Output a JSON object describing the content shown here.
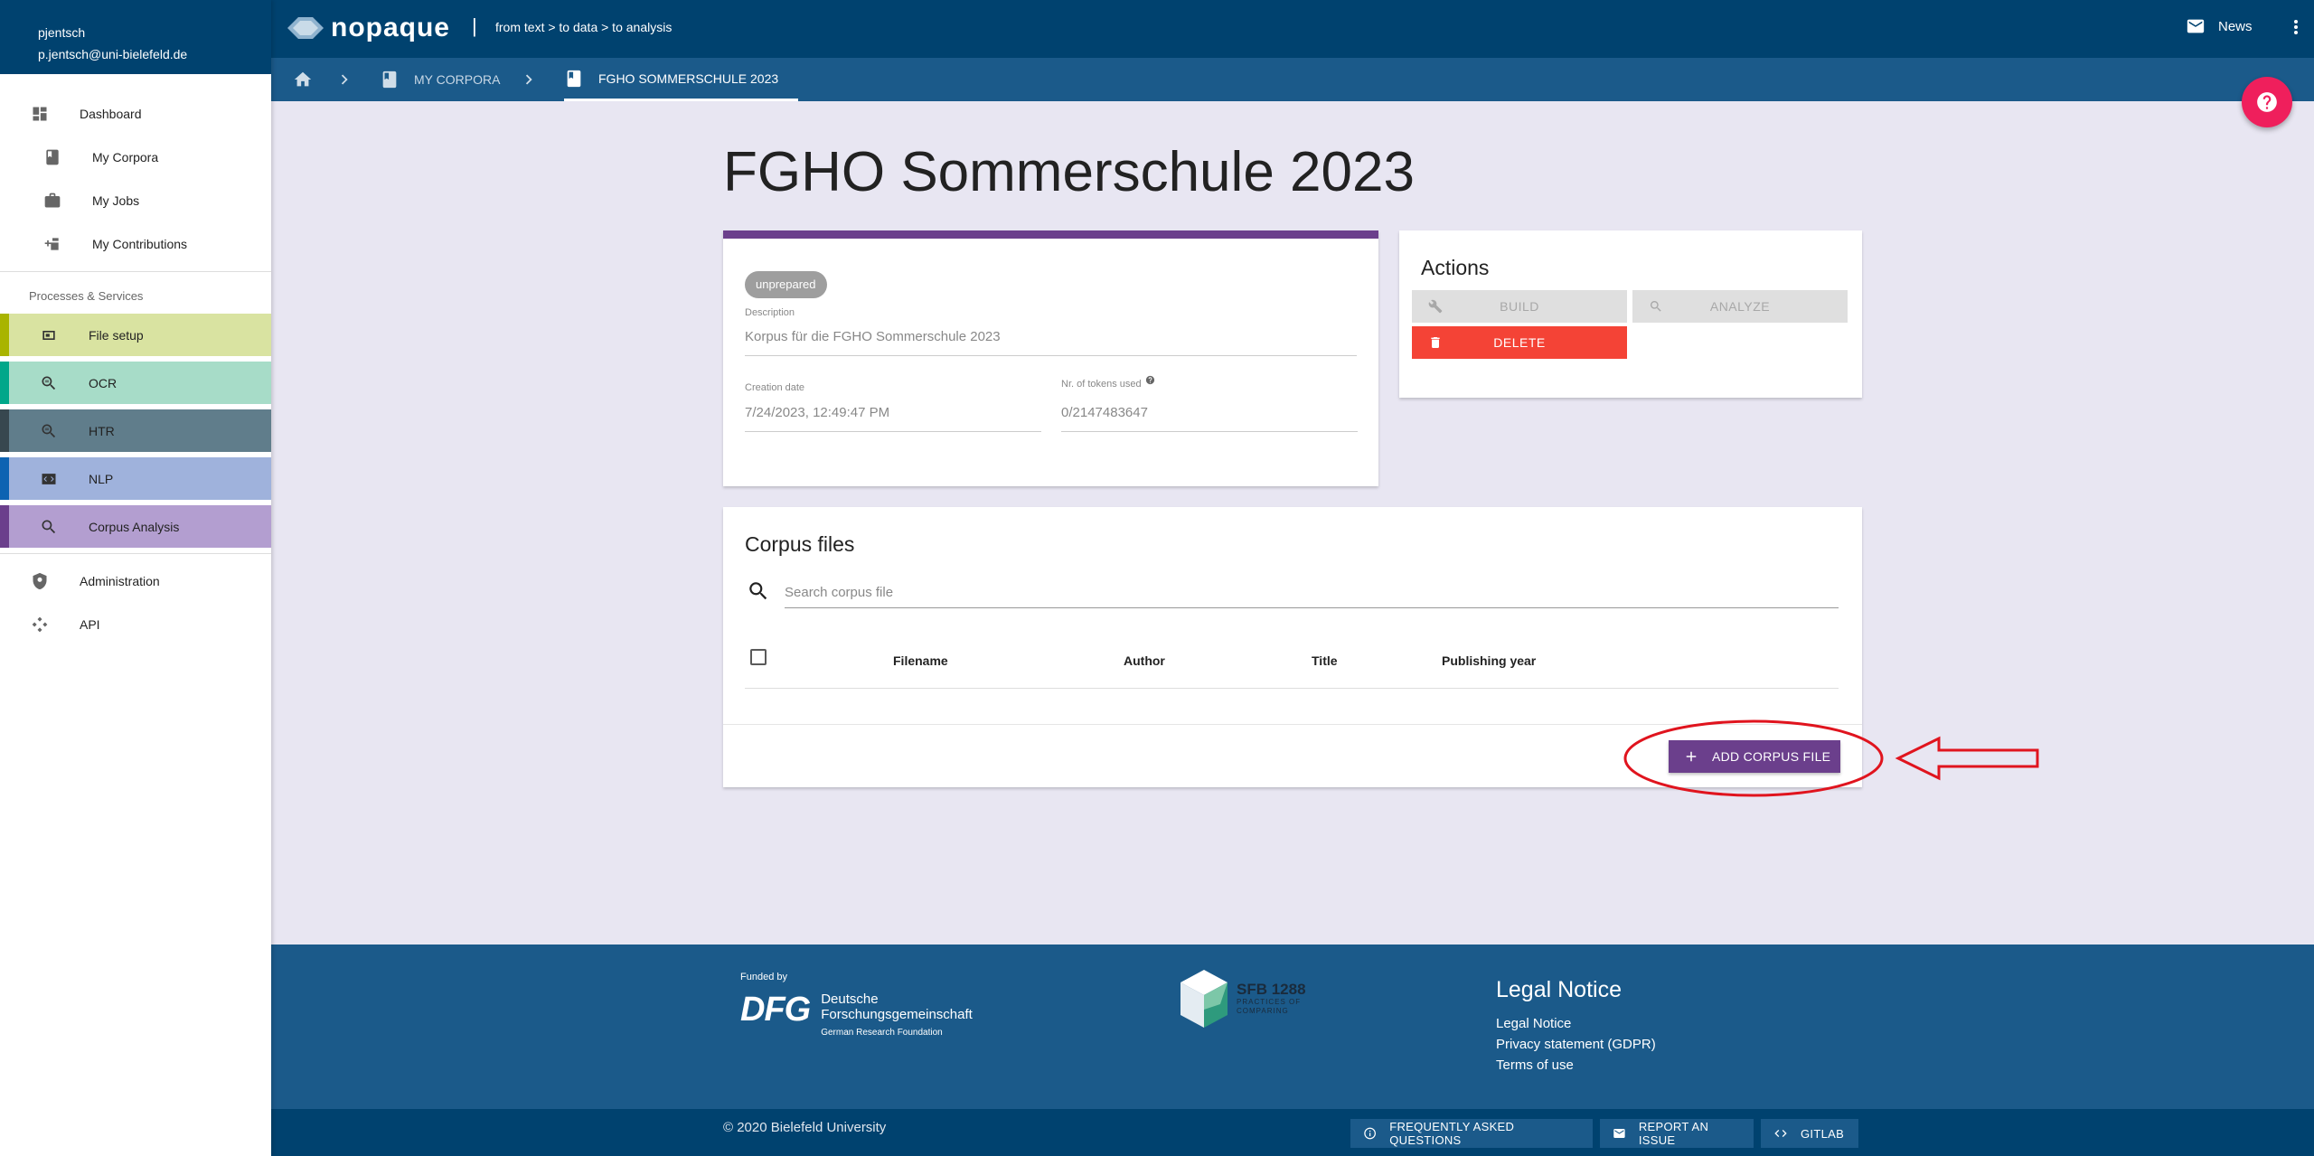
{
  "user": {
    "name": "pjentsch",
    "email": "p.jentsch@uni-bielefeld.de"
  },
  "sidebar": {
    "dashboard": "Dashboard",
    "my_corpora": "My Corpora",
    "my_jobs": "My Jobs",
    "my_contributions": "My Contributions",
    "processes_header": "Processes & Services",
    "services": [
      {
        "label": "File setup",
        "bg": "#d9e3a1",
        "accent": "#a9b400"
      },
      {
        "label": "OCR",
        "bg": "#a7dcc8",
        "accent": "#00a78a"
      },
      {
        "label": "HTR",
        "bg": "#607d8b",
        "accent": "#37474f"
      },
      {
        "label": "NLP",
        "bg": "#9fb2dc",
        "accent": "#0d63b2"
      },
      {
        "label": "Corpus Analysis",
        "bg": "#b39ed0",
        "accent": "#6b3f8c"
      }
    ],
    "administration": "Administration",
    "api": "API"
  },
  "topbar": {
    "brand": "nopaque",
    "separator": "|",
    "tagline": "from text > to data > to analysis",
    "news": "News"
  },
  "breadcrumb": {
    "corpora": "My Corpora",
    "current": "FGHO Sommerschule 2023"
  },
  "page": {
    "title": "FGHO Sommerschule 2023"
  },
  "corpus": {
    "status": "unprepared",
    "description_label": "Description",
    "description": "Korpus für die FGHO Sommerschule 2023",
    "creation_date_label": "Creation date",
    "creation_date": "7/24/2023, 12:49:47 PM",
    "tokens_label": "Nr. of tokens used",
    "tokens": "0/2147483647"
  },
  "actions": {
    "title": "Actions",
    "build": "Build",
    "analyze": "Analyze",
    "delete": "Delete"
  },
  "files": {
    "title": "Corpus files",
    "search_placeholder": "Search corpus file",
    "columns": [
      "Filename",
      "Author",
      "Title",
      "Publishing year"
    ],
    "add_button": "Add corpus file"
  },
  "footer": {
    "funded_by": "Funded by",
    "dfg_mark": "DFG",
    "dfg_name_line1": "Deutsche",
    "dfg_name_line2": "Forschungsgemeinschaft",
    "dfg_sub": "German Research Foundation",
    "sfb_title": "SFB 1288",
    "sfb_sub_line1": "PRACTICES OF",
    "sfb_sub_line2": "COMPARING",
    "legal_title": "Legal Notice",
    "legal_links": [
      "Legal Notice",
      "Privacy statement (GDPR)",
      "Terms of use"
    ],
    "copyright": "© 2020 Bielefeld University",
    "faq": "Frequently asked questions",
    "report": "Report an issue",
    "gitlab": "GitLab"
  },
  "colors": {
    "primary": "#00426f",
    "secondary": "#1b5a8a",
    "accent_purple": "#6b3f8c",
    "danger": "#f44336",
    "fab": "#ef1f5c",
    "annotation": "#e0141e"
  },
  "icons": [
    "dashboard-icon",
    "book-icon",
    "briefcase-icon",
    "contribution-icon",
    "file-setup-icon",
    "ocr-icon",
    "htr-icon",
    "nlp-icon",
    "search-icon",
    "admin-icon",
    "api-icon",
    "mail-icon",
    "more-vert-icon",
    "home-icon",
    "chevron-right-icon",
    "help-icon",
    "wrench-icon",
    "trash-icon",
    "add-icon",
    "info-icon",
    "code-icon"
  ]
}
